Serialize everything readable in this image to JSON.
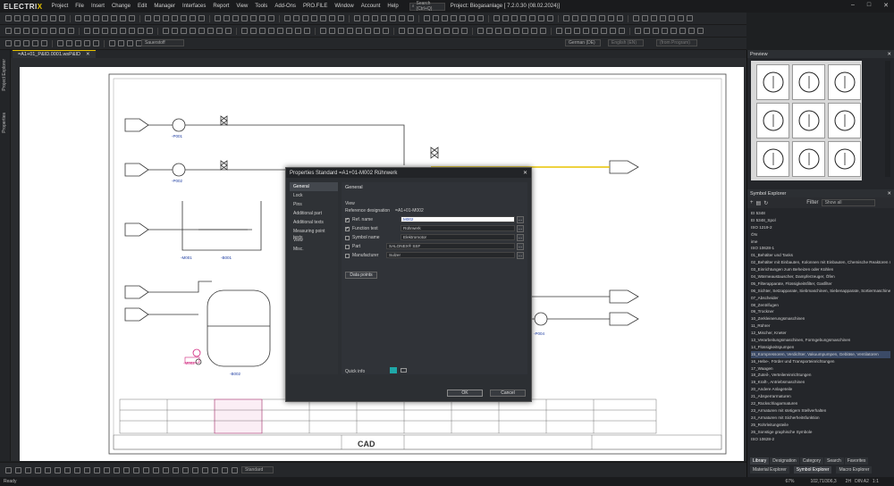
{
  "app": {
    "logo_left": "ELECTRI",
    "logo_right": "X",
    "menu": [
      "Project",
      "File",
      "Insert",
      "Change",
      "Edit",
      "Manager",
      "Interfaces",
      "Report",
      "View",
      "Tools",
      "Add-Ons",
      "PRO.FILE",
      "Window",
      "Account",
      "Help"
    ],
    "search_placeholder": "Search (Ctrl+Q)",
    "project_title": "Project: Biogasanlage  [ 7.2.0.30 (08.02.2024)]",
    "window_controls": [
      "–",
      "□",
      "✕"
    ]
  },
  "toolbar": {
    "material_select": "Sauerstoff",
    "language_select": "German (DE)",
    "language2_select": "English (EN)",
    "project_lang_select": "(from Program)"
  },
  "left_tabs": [
    "Project Explorer",
    "Properties"
  ],
  "document": {
    "tab_label": "=A1+01_P&ID.0001.wsP&ID",
    "close": "✕"
  },
  "drawing": {
    "tags": [
      "-P001",
      "-P002",
      "-B001",
      "-B002",
      "-P003",
      "-P004",
      "-M001",
      "-M002"
    ],
    "title_block_brand": "CAD"
  },
  "dialog": {
    "title": "Properties Standard  =A1+01-M002  Rührwerk",
    "close": "✕",
    "nav": [
      "General",
      "Lock",
      "Pins",
      "Additional part",
      "Additional texts",
      "Measuring point texts",
      "View",
      "Misc."
    ],
    "section": "General",
    "view_label": "View",
    "refdes_label": "Reference designation",
    "refdes_value": "=A1+01-M002",
    "rows": [
      {
        "label": "Ref. name",
        "checked": true,
        "value": "M002"
      },
      {
        "label": "Function text",
        "checked": true,
        "value": "Rührwerk"
      },
      {
        "label": "Symbol name",
        "checked": false,
        "value": "Elektromotor"
      },
      {
        "label": "Part",
        "checked": false,
        "value": "SALONEX® SSF"
      },
      {
        "label": "Manufacturer",
        "checked": false,
        "value": "Sulzer"
      }
    ],
    "data_points_button": "Data points",
    "quick_info_label": "Quick info",
    "ok_button": "OK",
    "cancel_button": "Cancel"
  },
  "preview": {
    "title": "Preview",
    "close": "✕"
  },
  "symbol_explorer": {
    "title": "Symbol Explorer",
    "filter_label": "Filter",
    "filter_value": "Show all",
    "items": [
      "EI 5348",
      "EI 5348_Spol",
      "ISO 1219-2",
      "ÖN",
      "ime",
      "ISO 10628-1",
      "01_Behälter und Tanks",
      "02_Behälter mit Einbauten, Kolonnen mit Einbauten, Chemische Reaktoren mit Einbauten",
      "03_Einrichtungen zum Beheizen oder Kühlen",
      "04_Wärmeaustauscher, Dampferzeuger, Öfen",
      "05_Filterapparate, Flüssigkeitsfilter, Gasfilter",
      "06_Sichter, Setzapparate, Siebmaschinen, Siebenapparate, Sortiermaschinen",
      "07_Abscheider",
      "08_Zentrifugen",
      "09_Trockner",
      "10_Zerkleinerungsmaschinen",
      "11_Rührer",
      "12_Mischer, Kneter",
      "13_Verarbeitungsmaschinen, Formgebungsmaschinen",
      "14_Flüssigkeitspumpen",
      "15_Kompressoren, Verdichter, Vakuumpumpen, Gebläse, Ventilatoren",
      "16_Hebe-, Förder und Transporteinrichtungen",
      "17_Waagen",
      "18_Zuteil-, Verteilereinrichtungen",
      "19_Kraft-, Antriebsmaschinen",
      "20_Andere Anlageteile",
      "21_Absperrarmaturen",
      "22_Rückschlagarmaturen",
      "23_Armaturen mit stetigem Stellverhalten",
      "24_Armaturen mit Sicherheitsfunktion",
      "25_Rohrleitungsteile",
      "26_Sonstige graphische Symbole",
      "ISO 10628-2"
    ],
    "selected_index": 20
  },
  "panel_tabs1": [
    "Library",
    "Designation",
    "Category",
    "Search",
    "Favorites"
  ],
  "panel_tabs2": [
    "Material Explorer",
    "Symbol Explorer",
    "Macro Explorer"
  ],
  "bottom_toolbar": {
    "layer_select": "Standard"
  },
  "status": {
    "left": "Ready",
    "zoom": "67%",
    "coords": "102,71/306,3",
    "grid": "2H",
    "sheet": "DIN A2",
    "scale": "1:1"
  }
}
